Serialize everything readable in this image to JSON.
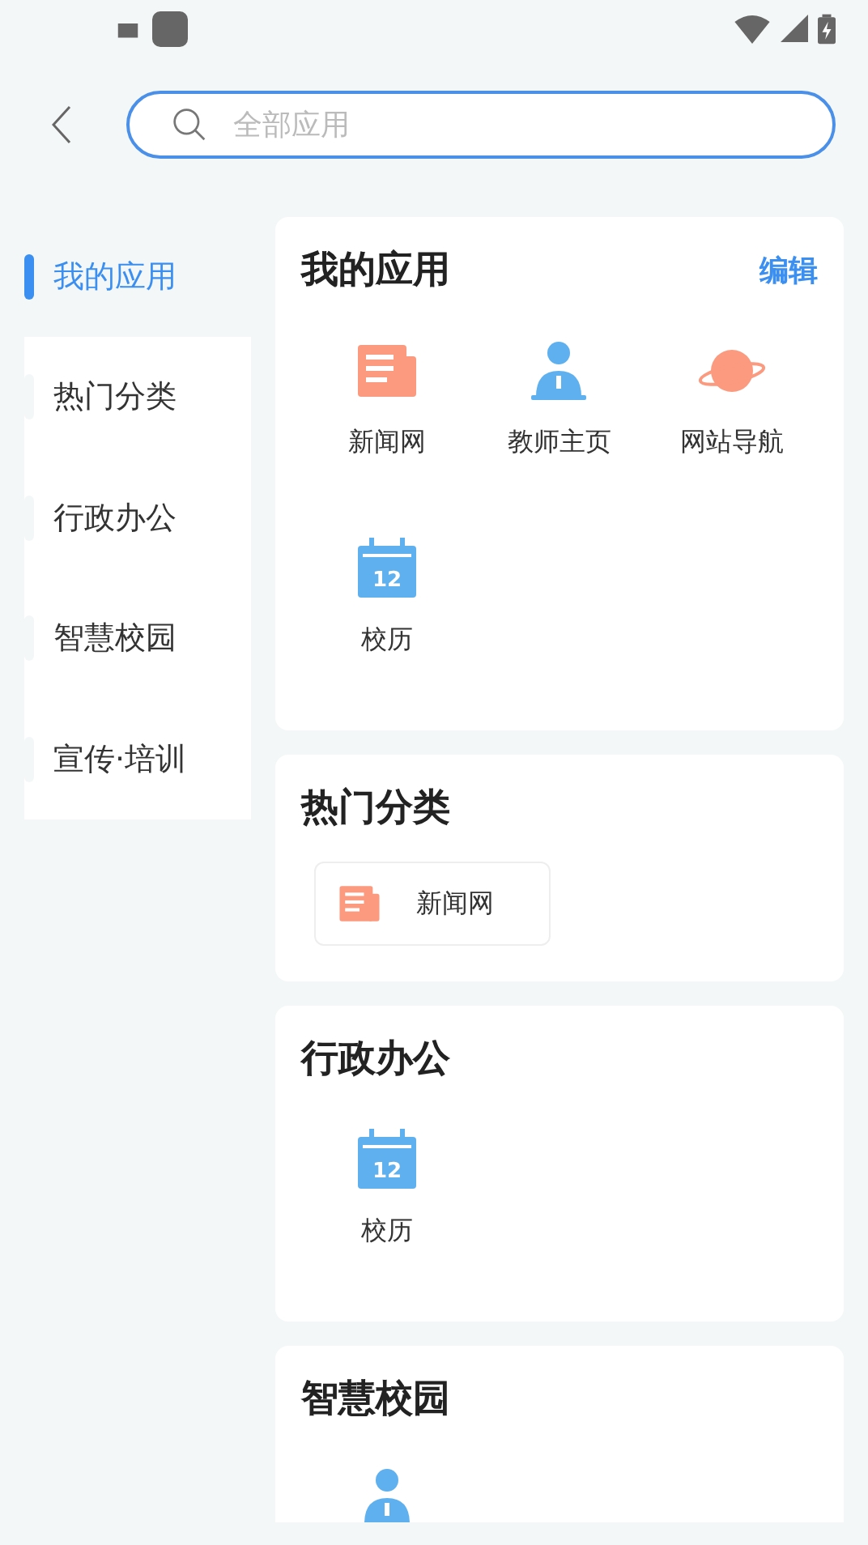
{
  "search": {
    "placeholder": "全部应用"
  },
  "sidebar": {
    "items": [
      {
        "label": "我的应用",
        "selected": true
      },
      {
        "label": "热门分类",
        "selected": false
      },
      {
        "label": "行政办公",
        "selected": false
      },
      {
        "label": "智慧校园",
        "selected": false
      },
      {
        "label": "宣传·培训",
        "selected": false
      }
    ]
  },
  "sections": [
    {
      "title": "我的应用",
      "action": "编辑",
      "kind": "grid",
      "items": [
        {
          "kind": "news",
          "label": "新闻网"
        },
        {
          "kind": "teacher",
          "label": "教师主页"
        },
        {
          "kind": "planet",
          "label": "网站导航"
        },
        {
          "kind": "calendar",
          "label": "校历",
          "icon_text": "12"
        }
      ]
    },
    {
      "title": "热门分类",
      "kind": "chips",
      "items": [
        {
          "kind": "news",
          "label": "新闻网"
        }
      ]
    },
    {
      "title": "行政办公",
      "kind": "grid",
      "items": [
        {
          "kind": "calendar",
          "label": "校历",
          "icon_text": "12"
        }
      ]
    },
    {
      "title": "智慧校园",
      "kind": "grid",
      "items": [
        {
          "kind": "teacher"
        }
      ]
    }
  ]
}
